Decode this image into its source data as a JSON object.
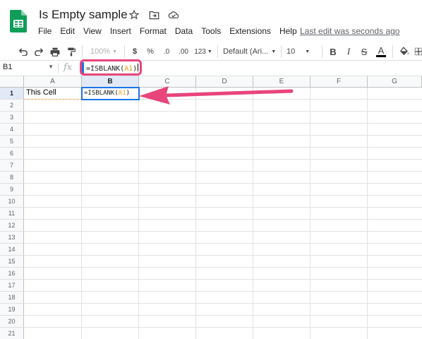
{
  "app": {
    "title": "Is Empty sample",
    "last_edit": "Last edit was seconds ago",
    "brand_color": "#0f9d58"
  },
  "menu": [
    "File",
    "Edit",
    "View",
    "Insert",
    "Format",
    "Data",
    "Tools",
    "Extensions",
    "Help"
  ],
  "toolbar": {
    "zoom": "100%",
    "currency": "$",
    "percent": "%",
    "dec_decrease": ".0",
    "dec_increase": ".00",
    "number_format": "123",
    "font": "Default (Ari...",
    "font_size": "10",
    "bold": "B",
    "italic": "I",
    "strike": "S",
    "text_color": "A"
  },
  "formula_bar": {
    "cell_ref": "B1",
    "fx": "fx",
    "formula_prefix": "=ISBLANK(",
    "formula_ref": "A1",
    "formula_suffix": ")"
  },
  "grid": {
    "columns": [
      "A",
      "B",
      "C",
      "D",
      "E",
      "F",
      "G"
    ],
    "rows": [
      "1",
      "2",
      "3",
      "4",
      "5",
      "6",
      "7",
      "8",
      "9",
      "10",
      "11",
      "12",
      "13",
      "14",
      "15",
      "16",
      "17",
      "18",
      "19",
      "20",
      "21"
    ],
    "active_column": "B",
    "active_row": "1",
    "cell_a1": "This Cell",
    "cell_b1_prefix": "=ISBLANK(",
    "cell_b1_ref": "A1",
    "cell_b1_suffix": ")"
  },
  "annotation": {
    "highlight_color": "#e8457b",
    "arrow_color": "#e8457b"
  }
}
